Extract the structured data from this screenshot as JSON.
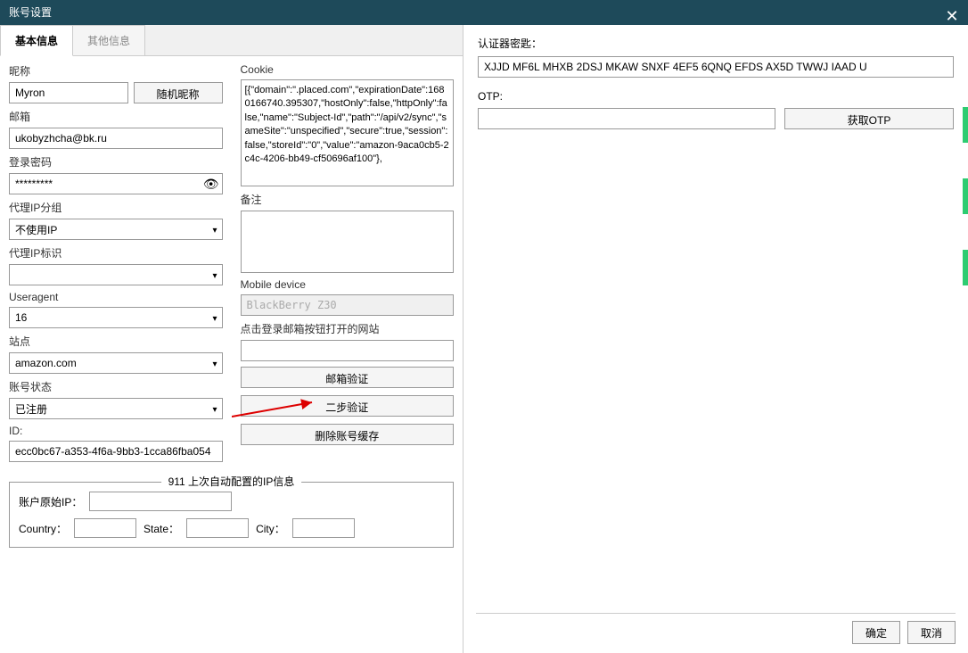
{
  "titlebar": {
    "title": "账号设置"
  },
  "tabs": {
    "basic": "基本信息",
    "other": "其他信息"
  },
  "left": {
    "nickname_label": "昵称",
    "nickname_value": "Myron",
    "random_nickname_btn": "随机昵称",
    "email_label": "邮箱",
    "email_value": "ukobyzhcha@bk.ru",
    "password_label": "登录密码",
    "password_value": "*********",
    "proxy_group_label": "代理IP分组",
    "proxy_group_value": "不使用IP",
    "proxy_id_label": "代理IP标识",
    "proxy_id_value": "",
    "useragent_label": "Useragent",
    "useragent_value": "16",
    "site_label": "站点",
    "site_value": "amazon.com",
    "status_label": "账号状态",
    "status_value": "已注册",
    "id_label": "ID:",
    "id_value": "ecc0bc67-a353-4f6a-9bb3-1cca86fba054"
  },
  "mid": {
    "cookie_label": "Cookie",
    "cookie_value": "[{\"domain\":\".placed.com\",\"expirationDate\":1680166740.395307,\"hostOnly\":false,\"httpOnly\":false,\"name\":\"Subject-Id\",\"path\":\"/api/v2/sync\",\"sameSite\":\"unspecified\",\"secure\":true,\"session\":false,\"storeId\":\"0\",\"value\":\"amazon-9aca0cb5-2c4c-4206-bb49-cf50696af100\"},",
    "remark_label": "备注",
    "mobile_label": "Mobile device",
    "mobile_value": "BlackBerry Z30",
    "login_site_label": "点击登录邮箱按钮打开的网站",
    "login_site_value": "",
    "email_verify_btn": "邮箱验证",
    "two_step_btn": "二步验证",
    "delete_cache_btn": "删除账号缓存"
  },
  "ipinfo": {
    "title": "911 上次自动配置的IP信息",
    "orig_ip_label": "账户原始IP：",
    "country_label": "Country：",
    "state_label": "State：",
    "city_label": "City："
  },
  "right": {
    "auth_key_label": "认证器密匙：",
    "auth_key_value": "XJJD MF6L MHXB 2DSJ MKAW SNXF 4EF5 6QNQ EFDS AX5D TWWJ IAAD U",
    "otp_label": "OTP:",
    "get_otp_btn": "获取OTP",
    "ok_btn": "确定",
    "cancel_btn": "取消"
  }
}
